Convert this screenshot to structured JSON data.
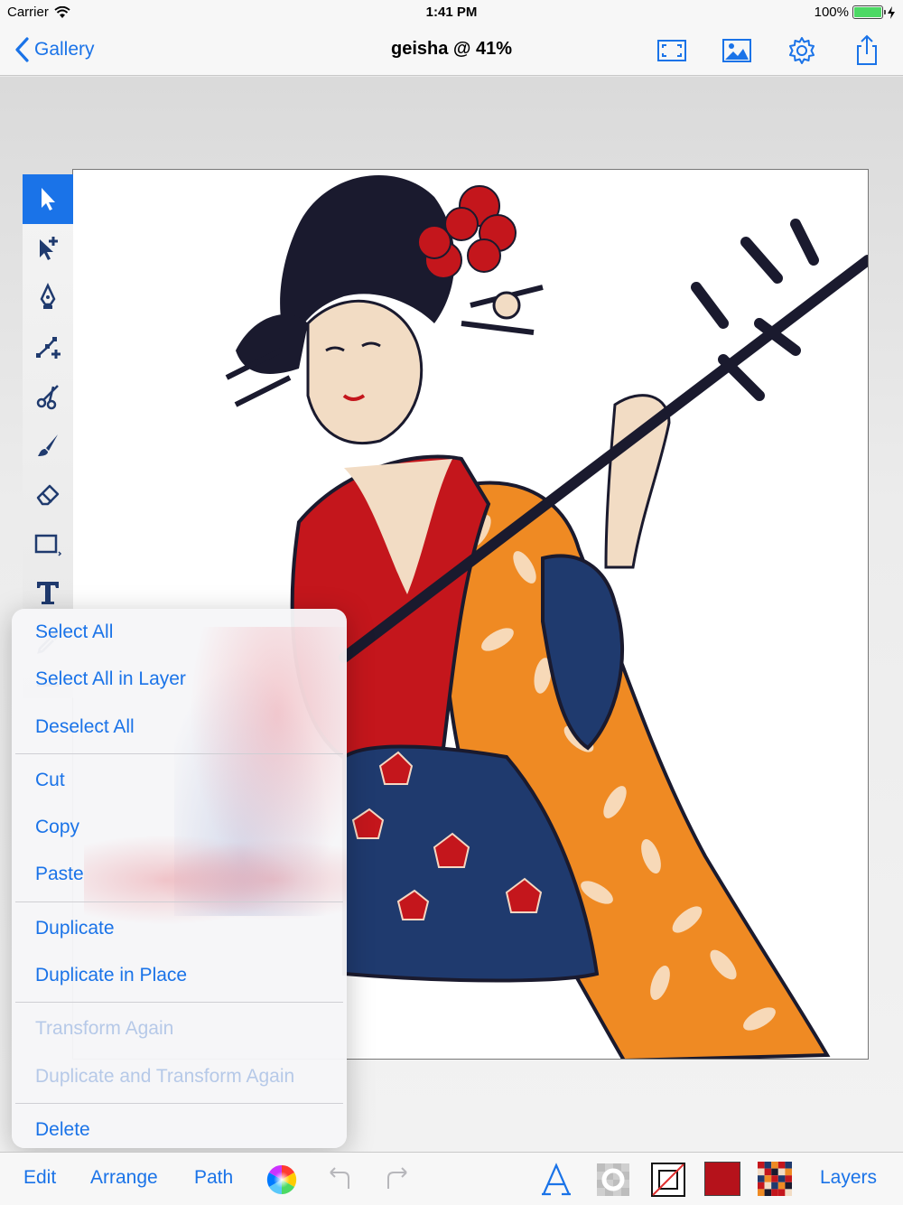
{
  "status": {
    "carrier": "Carrier",
    "time": "1:41 PM",
    "battery": "100%"
  },
  "nav": {
    "back_label": "Gallery",
    "title": "geisha @ 41%",
    "icons": [
      "fullscreen-icon",
      "image-icon",
      "gear-icon",
      "share-icon"
    ]
  },
  "tools": {
    "active": "select",
    "items": [
      "select-arrow-icon",
      "direct-select-icon",
      "pen-icon",
      "add-node-icon",
      "scissors-icon",
      "brush-icon",
      "eraser-icon",
      "rectangle-icon",
      "text-icon",
      "eyedropper-icon",
      "more-icon"
    ]
  },
  "menu": {
    "select_all": "Select All",
    "select_all_in_layer": "Select All in Layer",
    "deselect_all": "Deselect All",
    "cut": "Cut",
    "copy": "Copy",
    "paste": "Paste",
    "duplicate": "Duplicate",
    "duplicate_in_place": "Duplicate in Place",
    "transform_again": "Transform Again",
    "duplicate_and_transform_again": "Duplicate and Transform Again",
    "delete": "Delete"
  },
  "bottom": {
    "edit": "Edit",
    "arrange": "Arrange",
    "path": "Path",
    "layers": "Layers",
    "fill_color": "#b5121b",
    "accent": "#1a73e8"
  }
}
